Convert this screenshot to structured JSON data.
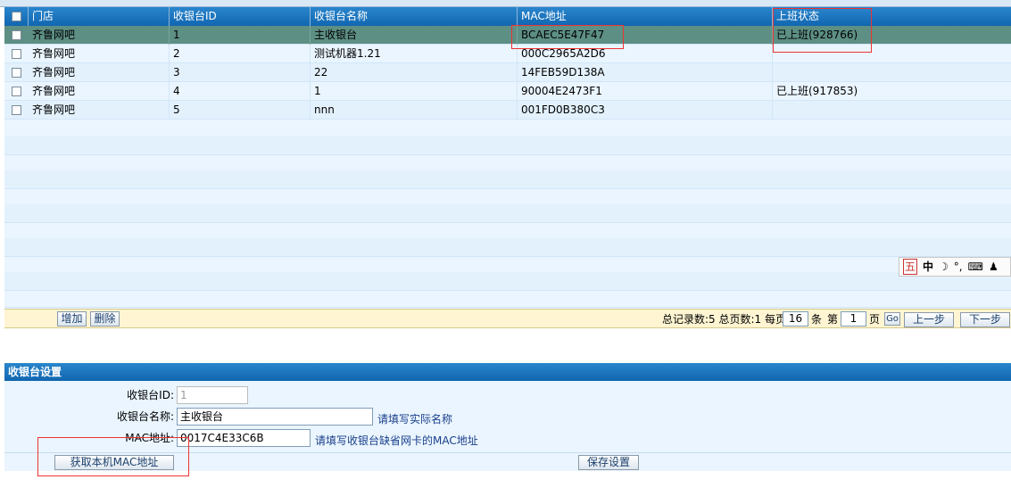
{
  "grid": {
    "columns": [
      "门店",
      "收银台ID",
      "收银台名称",
      "MAC地址",
      "上班状态"
    ],
    "rows": [
      {
        "store": "齐鲁网吧",
        "id": "1",
        "name": "主收银台",
        "mac": "BCAEC5E47F47",
        "status": "已上班(928766)",
        "selected": true
      },
      {
        "store": "齐鲁网吧",
        "id": "2",
        "name": "测试机器1.21",
        "mac": "000C2965A2D6",
        "status": ""
      },
      {
        "store": "齐鲁网吧",
        "id": "3",
        "name": "22",
        "mac": "14FEB59D138A",
        "status": ""
      },
      {
        "store": "齐鲁网吧",
        "id": "4",
        "name": "1",
        "mac": "90004E2473F1",
        "status": "已上班(917853)"
      },
      {
        "store": "齐鲁网吧",
        "id": "5",
        "name": "nnn",
        "mac": "001FD0B380C3",
        "status": ""
      }
    ]
  },
  "toolbar": {
    "add_label": "增加",
    "delete_label": "删除"
  },
  "pager": {
    "summary": "总记录数:5 总页数:1 每页",
    "page_size": "16",
    "unit_items": "条",
    "page_prefix": "第",
    "current_page": "1",
    "unit_page": "页",
    "go_label": "Go",
    "prev_label": "上一步",
    "next_label": "下一步"
  },
  "ime": {
    "items": [
      "五",
      "中",
      "☽",
      "°,",
      "⌨",
      "♟"
    ]
  },
  "form": {
    "title": "收银台设置",
    "id_label": "收银台ID:",
    "id_value": "1",
    "name_label": "收银台名称:",
    "name_value": "主收银台",
    "name_hint": "请填写实际名称",
    "mac_label": "MAC地址:",
    "mac_value": "0017C4E33C6B",
    "mac_hint": "请填写收银台缺省网卡的MAC地址",
    "get_mac_label": "获取本机MAC地址",
    "save_label": "保存设置"
  },
  "colors": {
    "header_blue": "#1a72bd",
    "selected_row": "#5d8f84",
    "annotation_red": "#e33333"
  }
}
